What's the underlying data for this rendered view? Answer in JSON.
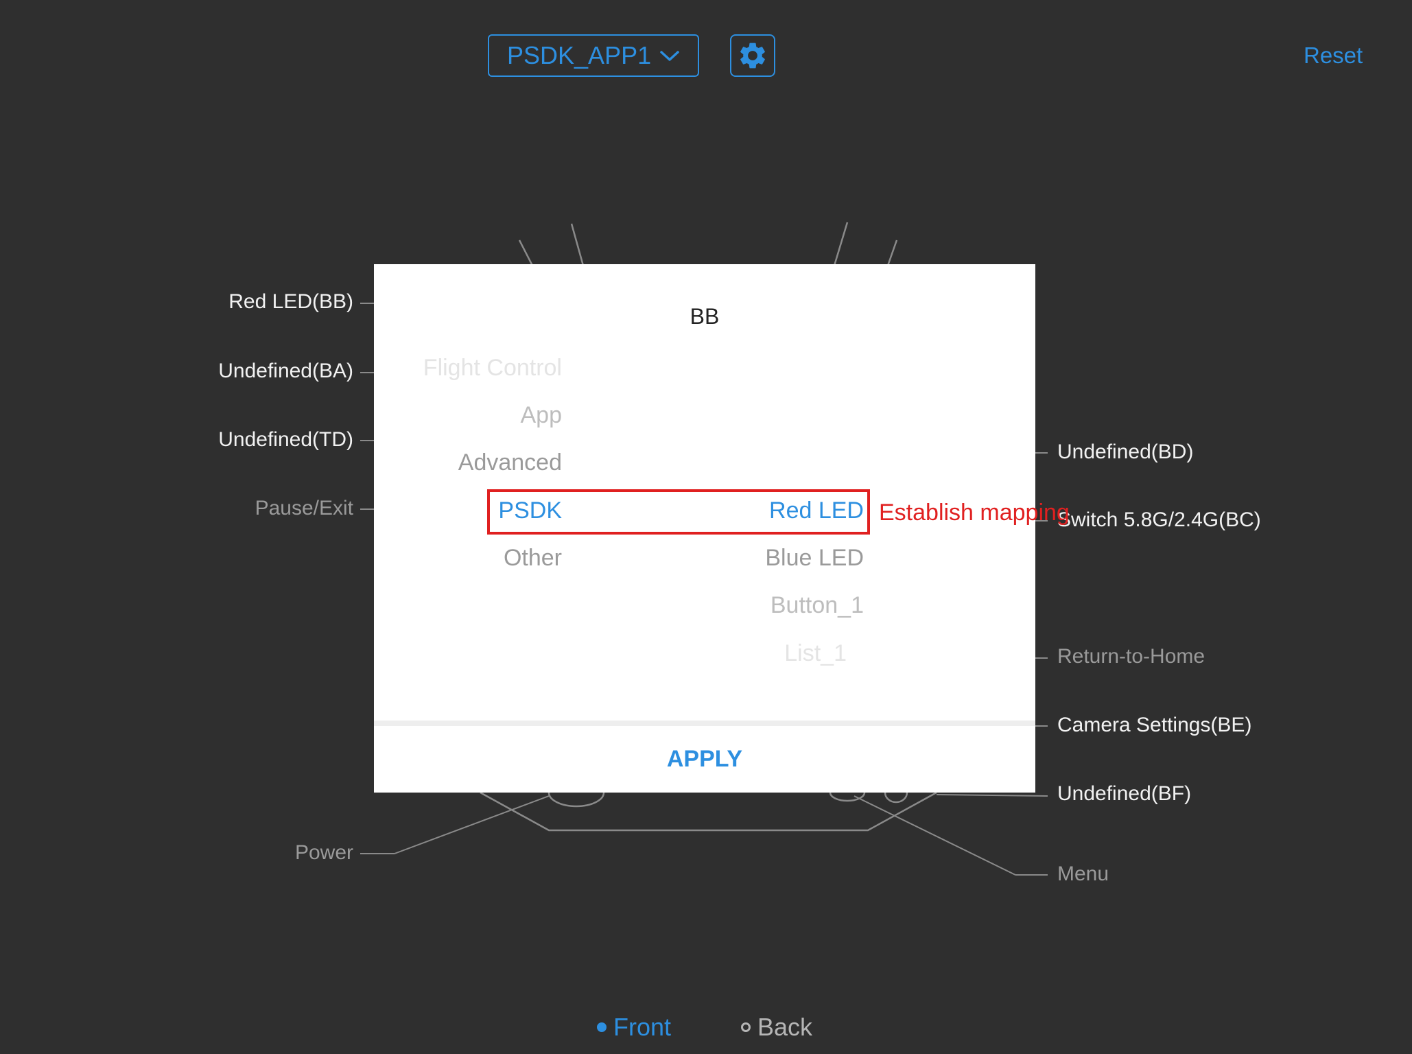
{
  "header": {
    "app_select_value": "PSDK_APP1",
    "reset_label": "Reset"
  },
  "left_labels": [
    "Red LED(BB)",
    "Undefined(BA)",
    "Undefined(TD)",
    "Pause/Exit",
    "Power"
  ],
  "right_labels": [
    "Undefined(BD)",
    "Switch 5.8G/2.4G(BC)",
    "Return-to-Home",
    "Camera Settings(BE)",
    "Undefined(BF)",
    "Menu"
  ],
  "dialog": {
    "title": "BB",
    "category_options": [
      "Flight Control",
      "App",
      "Advanced",
      "PSDK",
      "Other"
    ],
    "selected_category": "PSDK",
    "function_options": [
      "Red LED",
      "Blue LED",
      "Button_1",
      "List_1"
    ],
    "selected_function": "Red LED",
    "apply_label": "APPLY"
  },
  "annotation": "Establish mapping",
  "view_toggle": {
    "front_label": "Front",
    "back_label": "Back",
    "selected": "Front"
  },
  "colors": {
    "background": "#2f2f2f",
    "accent": "#2d8fe0",
    "annotation_red": "#e02020"
  }
}
